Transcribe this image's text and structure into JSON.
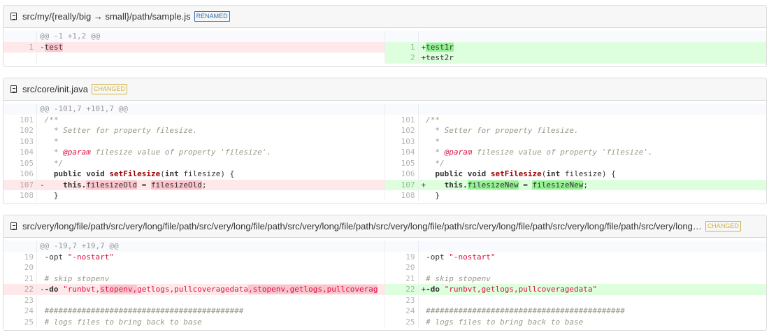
{
  "colors": {
    "deleted_bg": "#fee8e9",
    "deleted_highlight": "#fac5cd",
    "inserted_bg": "#dfd",
    "inserted_highlight": "#97f295",
    "renamed": "#3572b0",
    "changed": "#d0b44c"
  },
  "files": [
    {
      "name": "src/my/{really/big → small}/path/sample.js",
      "badge": "RENAMED",
      "badge_type": "renamed",
      "icon": "file-icon",
      "left": [
        {
          "type": "hunk",
          "ln": "",
          "code": [
            {
              "t": "@@ -1 +1,2 @@"
            }
          ]
        },
        {
          "type": "del",
          "ln": "1",
          "code": [
            {
              "t": "-"
            },
            {
              "t": "test",
              "h": 1
            }
          ]
        },
        {
          "type": "empty",
          "ln": "",
          "code": []
        }
      ],
      "right": [
        {
          "type": "hunk",
          "ln": "",
          "code": []
        },
        {
          "type": "ins",
          "ln": "1",
          "code": [
            {
              "t": "+"
            },
            {
              "t": "test1r",
              "h": 1
            }
          ]
        },
        {
          "type": "ins",
          "ln": "2",
          "code": [
            {
              "t": "+test2r"
            }
          ]
        }
      ]
    },
    {
      "name": "src/core/init.java",
      "badge": "CHANGED",
      "badge_type": "changed",
      "icon": "file-icon",
      "left": [
        {
          "type": "hunk",
          "ln": "",
          "code": [
            {
              "t": "@@ -101,7 +101,7 @@"
            }
          ]
        },
        {
          "type": "ctx",
          "ln": "101",
          "code": [
            {
              "t": " "
            },
            {
              "t": "/**",
              "c": "c"
            }
          ]
        },
        {
          "type": "ctx",
          "ln": "102",
          "code": [
            {
              "t": "   * Setter for property filesize.",
              "c": "c"
            }
          ]
        },
        {
          "type": "ctx",
          "ln": "103",
          "code": [
            {
              "t": "   *",
              "c": "c"
            }
          ]
        },
        {
          "type": "ctx",
          "ln": "104",
          "code": [
            {
              "t": "   * ",
              "c": "c"
            },
            {
              "t": "@param",
              "c": "d"
            },
            {
              "t": " filesize value of property 'filesize'.",
              "c": "c"
            }
          ]
        },
        {
          "type": "ctx",
          "ln": "105",
          "code": [
            {
              "t": "   */",
              "c": "c"
            }
          ]
        },
        {
          "type": "ctx",
          "ln": "106",
          "code": [
            {
              "t": "   "
            },
            {
              "t": "public void",
              "c": "k"
            },
            {
              "t": " "
            },
            {
              "t": "setFilesize",
              "c": "f"
            },
            {
              "t": "("
            },
            {
              "t": "int",
              "c": "k"
            },
            {
              "t": " filesize) {"
            }
          ]
        },
        {
          "type": "del",
          "ln": "107",
          "code": [
            {
              "t": "-    "
            },
            {
              "t": "this.",
              "c": "k"
            },
            {
              "t": "filesizeOld",
              "h": 1
            },
            {
              "t": " = "
            },
            {
              "t": "filesizeOld",
              "h": 1
            },
            {
              "t": ";"
            }
          ]
        },
        {
          "type": "ctx",
          "ln": "108",
          "code": [
            {
              "t": "   }"
            }
          ]
        }
      ],
      "right": [
        {
          "type": "hunk",
          "ln": "",
          "code": []
        },
        {
          "type": "ctx",
          "ln": "101",
          "code": [
            {
              "t": " "
            },
            {
              "t": "/**",
              "c": "c"
            }
          ]
        },
        {
          "type": "ctx",
          "ln": "102",
          "code": [
            {
              "t": "   * Setter for property filesize.",
              "c": "c"
            }
          ]
        },
        {
          "type": "ctx",
          "ln": "103",
          "code": [
            {
              "t": "   *",
              "c": "c"
            }
          ]
        },
        {
          "type": "ctx",
          "ln": "104",
          "code": [
            {
              "t": "   * ",
              "c": "c"
            },
            {
              "t": "@param",
              "c": "d"
            },
            {
              "t": " filesize value of property 'filesize'.",
              "c": "c"
            }
          ]
        },
        {
          "type": "ctx",
          "ln": "105",
          "code": [
            {
              "t": "   */",
              "c": "c"
            }
          ]
        },
        {
          "type": "ctx",
          "ln": "106",
          "code": [
            {
              "t": "   "
            },
            {
              "t": "public void",
              "c": "k"
            },
            {
              "t": " "
            },
            {
              "t": "setFilesize",
              "c": "f"
            },
            {
              "t": "("
            },
            {
              "t": "int",
              "c": "k"
            },
            {
              "t": " filesize) {"
            }
          ]
        },
        {
          "type": "ins",
          "ln": "107",
          "code": [
            {
              "t": "+    "
            },
            {
              "t": "this.",
              "c": "k"
            },
            {
              "t": "filesizeNew",
              "h": 1
            },
            {
              "t": " = "
            },
            {
              "t": "filesizeNew",
              "h": 1
            },
            {
              "t": ";"
            }
          ]
        },
        {
          "type": "ctx",
          "ln": "108",
          "code": [
            {
              "t": "   }"
            }
          ]
        }
      ]
    },
    {
      "name": "src/very/long/file/path/src/very/long/file/path/src/very/long/file/path/src/very/long/file/path/src/very/long/file/path/src/very/long/file/path/src/very/long/file/path/src/very/long…",
      "badge": "CHANGED",
      "badge_type": "changed",
      "icon": "file-icon",
      "left": [
        {
          "type": "hunk",
          "ln": "",
          "code": [
            {
              "t": "@@ -19,7 +19,7 @@"
            }
          ]
        },
        {
          "type": "ctx",
          "ln": "19",
          "code": [
            {
              "t": " -opt "
            },
            {
              "t": "\"-nostart\"",
              "c": "s"
            }
          ]
        },
        {
          "type": "ctx",
          "ln": "20",
          "code": []
        },
        {
          "type": "ctx",
          "ln": "21",
          "code": [
            {
              "t": " # skip stopenv",
              "c": "c"
            }
          ]
        },
        {
          "type": "del",
          "ln": "22",
          "code": [
            {
              "t": "-"
            },
            {
              "t": "-do",
              "c": "k"
            },
            {
              "t": " "
            },
            {
              "t": "\"runbvt,",
              "c": "s"
            },
            {
              "t": "stopenv,",
              "c": "s",
              "h": 1
            },
            {
              "t": "getlogs,pullcoveragedata",
              "c": "s"
            },
            {
              "t": ",stopenv,getlogs,pullcoverag",
              "c": "s",
              "h": 1
            }
          ]
        },
        {
          "type": "ctx",
          "ln": "23",
          "code": []
        },
        {
          "type": "ctx",
          "ln": "24",
          "code": [
            {
              "t": " ###########################################",
              "c": "c"
            }
          ]
        },
        {
          "type": "ctx",
          "ln": "25",
          "code": [
            {
              "t": " # logs files to bring back to base",
              "c": "c"
            }
          ]
        }
      ],
      "right": [
        {
          "type": "hunk",
          "ln": "",
          "code": []
        },
        {
          "type": "ctx",
          "ln": "19",
          "code": [
            {
              "t": " -opt "
            },
            {
              "t": "\"-nostart\"",
              "c": "s"
            }
          ]
        },
        {
          "type": "ctx",
          "ln": "20",
          "code": []
        },
        {
          "type": "ctx",
          "ln": "21",
          "code": [
            {
              "t": " # skip stopenv",
              "c": "c"
            }
          ]
        },
        {
          "type": "ins",
          "ln": "22",
          "code": [
            {
              "t": "+"
            },
            {
              "t": "-do",
              "c": "k"
            },
            {
              "t": " "
            },
            {
              "t": "\"runbvt,getlogs,pullcoveragedata\"",
              "c": "s"
            }
          ]
        },
        {
          "type": "ctx",
          "ln": "23",
          "code": []
        },
        {
          "type": "ctx",
          "ln": "24",
          "code": [
            {
              "t": " ###########################################",
              "c": "c"
            }
          ]
        },
        {
          "type": "ctx",
          "ln": "25",
          "code": [
            {
              "t": " # logs files to bring back to base",
              "c": "c"
            }
          ]
        }
      ]
    }
  ]
}
